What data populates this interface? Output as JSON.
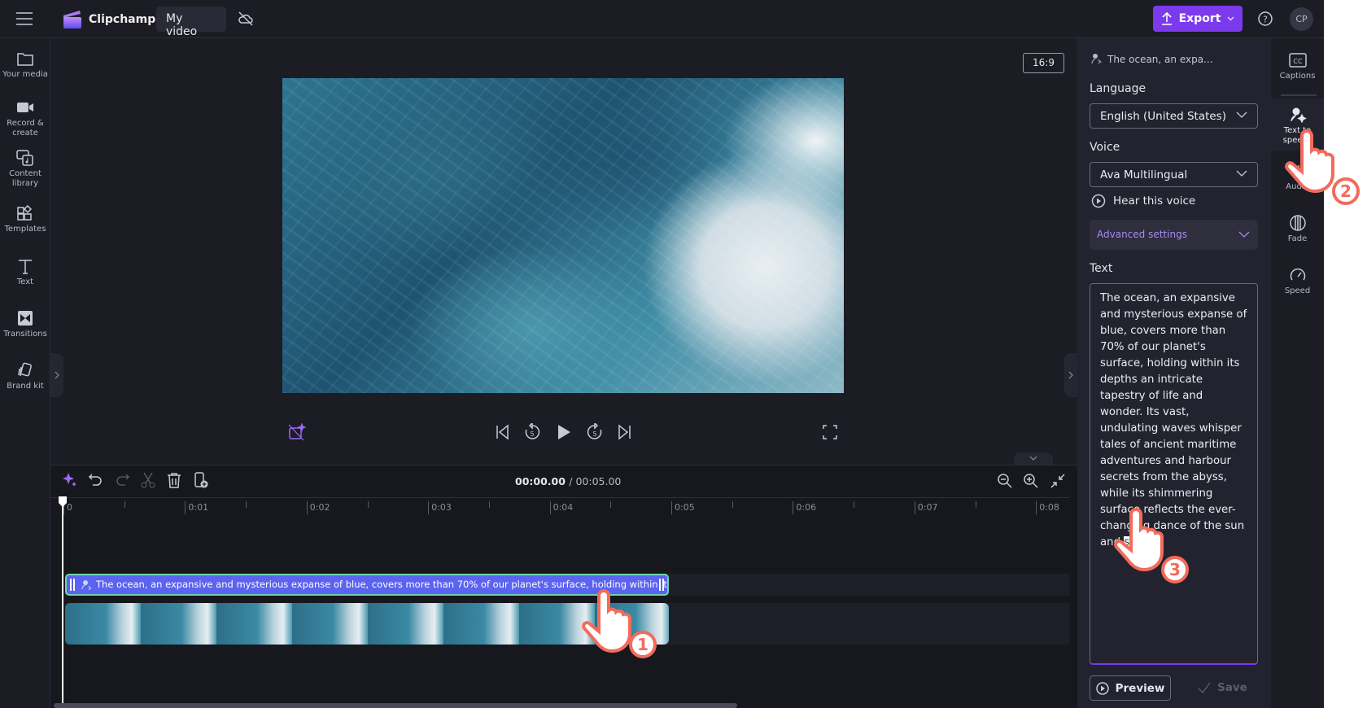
{
  "header": {
    "app_name": "Clipchamp",
    "project_title": "My video",
    "export_label": "Export",
    "avatar_initials": "CP"
  },
  "sidebar": {
    "items": [
      {
        "label": "Your media",
        "icon": "folder-icon"
      },
      {
        "label": "Record &\ncreate",
        "icon": "camera-icon"
      },
      {
        "label": "Content\nlibrary",
        "icon": "content-library-icon"
      },
      {
        "label": "Templates",
        "icon": "templates-icon"
      },
      {
        "label": "Text",
        "icon": "text-icon"
      },
      {
        "label": "Transitions",
        "icon": "transitions-icon"
      },
      {
        "label": "Brand kit",
        "icon": "brand-kit-icon"
      }
    ]
  },
  "preview": {
    "aspect_ratio": "16:9"
  },
  "timeline": {
    "current_time": "00:00.00",
    "total_time": "/ 00:05.00",
    "ruler": [
      "0",
      "0:01",
      "0:02",
      "0:03",
      "0:04",
      "0:05",
      "0:06",
      "0:07",
      "0:08"
    ],
    "text_clip": "The ocean, an expansive and mysterious expanse of blue, covers more than 70% of our planet's surface, holding within its depths"
  },
  "panel": {
    "clip_title": "The ocean, an expa...",
    "language_label": "Language",
    "language_value": "English (United States)",
    "voice_label": "Voice",
    "voice_value": "Ava Multilingual",
    "hear_voice": "Hear this voice",
    "advanced": "Advanced settings",
    "text_label": "Text",
    "text_main": "The ocean, an expansive and mysterious expanse of blue, covers more than 70% of our planet's surface, holding within its depths an intricate tapestry of life and wonder. Its vast, undulating waves whisper tales of ancient maritime adventures and harbour secrets from the abyss, while its shimmering surface reflects the ever-changing dance of the sun and ",
    "text_selected": "sky.",
    "preview_label": "Preview",
    "save_label": "Save"
  },
  "right_tabs": [
    {
      "label": "Captions",
      "icon": "captions-icon"
    },
    {
      "label": "Text to speech",
      "icon": "text-to-speech-icon",
      "selected": true
    },
    {
      "label": "Audio",
      "icon": "audio-icon"
    },
    {
      "label": "Fade",
      "icon": "fade-icon"
    },
    {
      "label": "Speed",
      "icon": "speed-icon"
    }
  ],
  "annotations": [
    "1",
    "2",
    "3"
  ],
  "colors": {
    "accent": "#7c3aed",
    "text_clip": "#5b63f0",
    "text_clip_border": "#6fd3ae",
    "cursor": "#f26b5b"
  }
}
